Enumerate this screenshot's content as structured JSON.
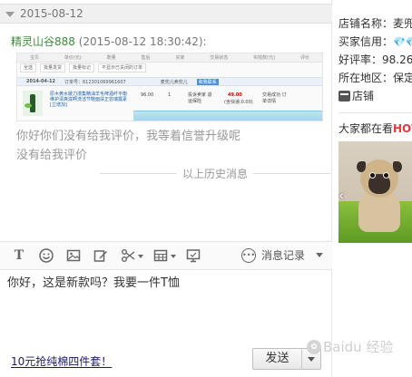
{
  "chat": {
    "date": "2015-08-12",
    "sender_name": "精灵山谷888",
    "sender_time": "(2015-08-12 18:30:42):",
    "messages": [
      "你好你们没有给我评价，我等着信誉升级呢",
      "没有给我评价"
    ],
    "history_divider": "以上历史消息"
  },
  "order_screenshot": {
    "headers": [
      "宝贝",
      "单价(元)",
      "数量",
      "售后",
      "买家",
      "交易状态",
      "实收款(元)",
      "评价"
    ],
    "tabs": [
      "全选",
      "批量发货",
      "批量标记",
      "不显示已关闭的订单"
    ],
    "date": "2014-04-12",
    "order_no": "订单号：612301069961607",
    "seller": "麦兜儿卖兜儿",
    "tag": "和我联系",
    "product_desc": "原木黄水媛刀漫集精油羊毛啤酒纤平衡维护清爽滋啊洗洁节鞋面扶正芸瑞露素[立增加]",
    "unit_price": "96.00",
    "quantity": "1",
    "refund": "投诉卖家 退运保险",
    "total": "49.00",
    "shipping": "(含快递:0.00)",
    "status": "交易成功 订单详情"
  },
  "toolbar": {
    "records_label": "消息记录"
  },
  "composer": {
    "input_text": "你好，这是新款吗？我要一件T恤",
    "promo_link": "10元抢纯棉四件套！",
    "send_label": "发送"
  },
  "shop": {
    "name_line": "店铺名称：麦兜",
    "credit_label": "买家信用：",
    "rating_line": "好评率：98.26",
    "region_line": "所在地区：保定",
    "shop_link": "店铺",
    "watching_prefix": "大家都在看",
    "watching_hot": "HOT"
  },
  "watermark": "Baidu 经验",
  "colors": {
    "sender_green": "#3b8c3b",
    "hot_red": "#e4393c",
    "diamond_blue": "#2aa5e0"
  }
}
